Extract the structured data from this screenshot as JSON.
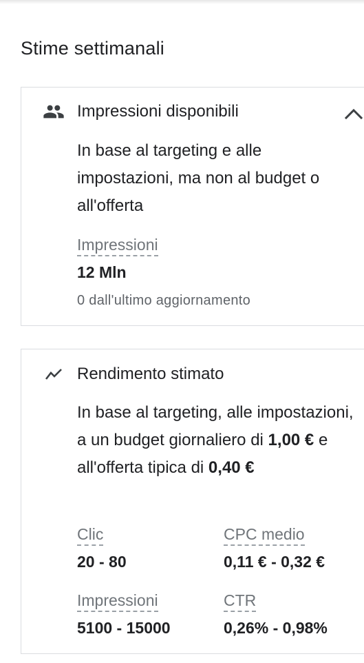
{
  "page": {
    "title": "Stime settimanali"
  },
  "impressions_card": {
    "icon": "people-icon",
    "title": "Impressioni disponibili",
    "description": "In base al targeting e alle impostazioni, ma non al budget o all'offerta",
    "metric_label": "Impressioni",
    "metric_value": "12 Mln",
    "metric_note": "0 dall'ultimo aggiornamento",
    "toggle_icon": "chevron-up-icon"
  },
  "performance_card": {
    "icon": "trending-icon",
    "title": "Rendimento stimato",
    "description_part1": "In base al targeting, alle impostazioni, a un budget giornaliero di ",
    "budget": "1,00 €",
    "description_part2": " e all'offerta tipica di ",
    "bid": "0,40 €",
    "metrics": [
      {
        "label": "Clic",
        "value": "20 - 80"
      },
      {
        "label": "CPC medio",
        "value": "0,11 € - 0,32 €"
      },
      {
        "label": "Impressioni",
        "value": "5100 - 15000"
      },
      {
        "label": "CTR",
        "value": "0,26% - 0,98%"
      }
    ]
  }
}
